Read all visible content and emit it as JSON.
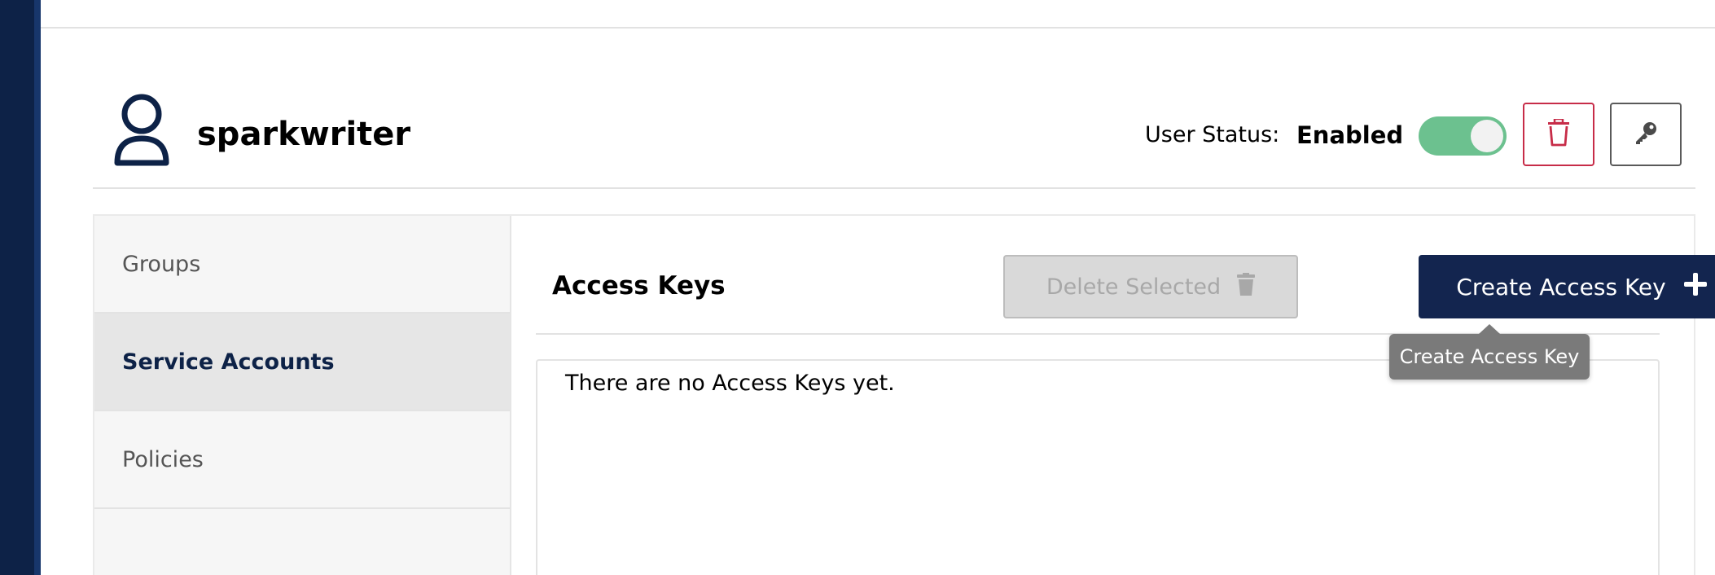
{
  "user": {
    "name": "sparkwriter",
    "avatar_icon": "user-icon"
  },
  "status": {
    "label": "User Status:",
    "value": "Enabled",
    "enabled": true
  },
  "header_actions": {
    "delete_icon": "trash-icon",
    "policy_icon": "key-icon"
  },
  "side_menu": {
    "items": [
      {
        "label": "Groups",
        "active": false
      },
      {
        "label": "Service Accounts",
        "active": true
      },
      {
        "label": "Policies",
        "active": false
      }
    ]
  },
  "access_keys": {
    "title": "Access Keys",
    "delete_selected_label": "Delete Selected",
    "create_label": "Create Access Key",
    "empty_message": "There are no Access Keys yet.",
    "tooltip": "Create Access Key"
  },
  "colors": {
    "nav_dark": "#0d2247",
    "primary_button": "#13254f",
    "toggle_on": "#6cc18f",
    "danger": "#c72c48"
  }
}
